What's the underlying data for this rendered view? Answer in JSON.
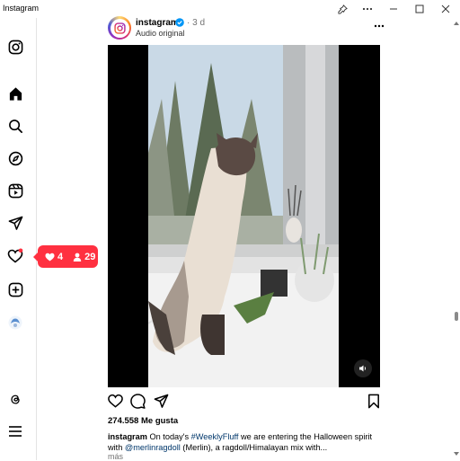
{
  "window": {
    "title": "Instagram"
  },
  "sidebar": {
    "items": [
      {
        "name": "instagram-logo-icon"
      },
      {
        "name": "home-icon"
      },
      {
        "name": "search-icon"
      },
      {
        "name": "explore-icon"
      },
      {
        "name": "reels-icon"
      },
      {
        "name": "messages-icon"
      },
      {
        "name": "notifications-icon"
      },
      {
        "name": "create-icon"
      },
      {
        "name": "profile-avatar-icon"
      },
      {
        "name": "threads-icon"
      },
      {
        "name": "menu-icon"
      }
    ]
  },
  "notifications_popup": {
    "likes": "4",
    "followers": "29",
    "accent": "#ff3040"
  },
  "post": {
    "username": "instagram",
    "time": "· 3 d",
    "audio": "Audio original",
    "likes": "274.558 Me gusta",
    "caption": {
      "user": "instagram",
      "text_1": " On today's ",
      "hashtag": "#WeeklyFluff",
      "text_2": " we are entering the Halloween spirit with ",
      "mention": "@merlinragdoll",
      "text_3": " (Merlin), a ragdoll/Himalayan mix with..."
    },
    "more": "más"
  },
  "colors": {
    "link": "#00376b",
    "verified": "#0095f6"
  }
}
